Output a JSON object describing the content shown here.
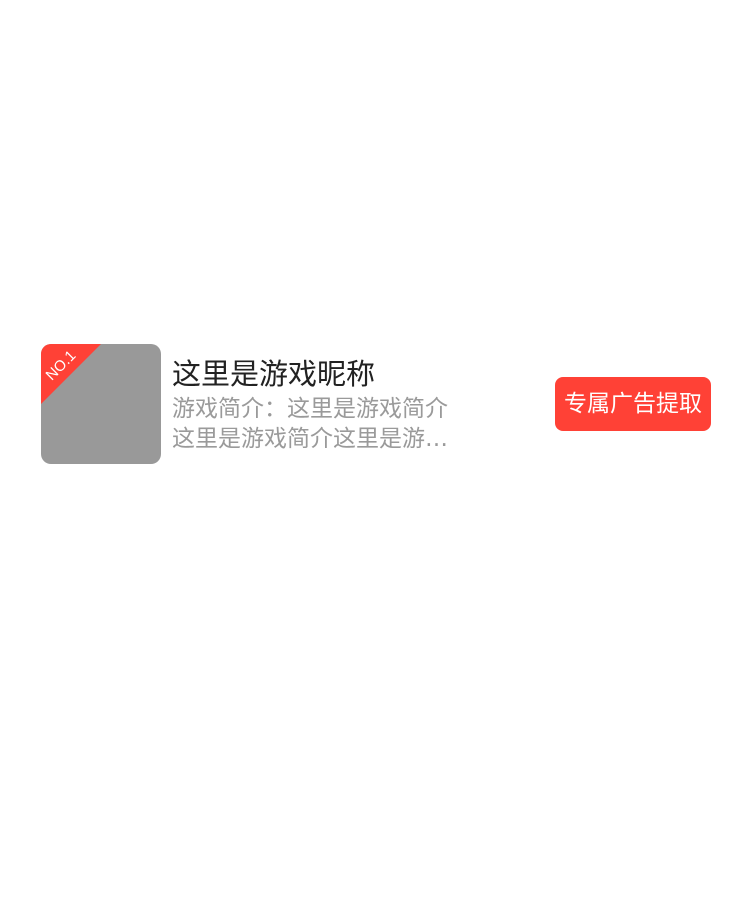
{
  "game": {
    "rank": "NO.1",
    "name": "这里是游戏昵称",
    "intro": "游戏简介：这里是游戏简介这里是游戏简介这里是游戏简介",
    "button_label": "专属广告提取",
    "accent_color": "#ff4136",
    "thumb_color": "#999999"
  }
}
